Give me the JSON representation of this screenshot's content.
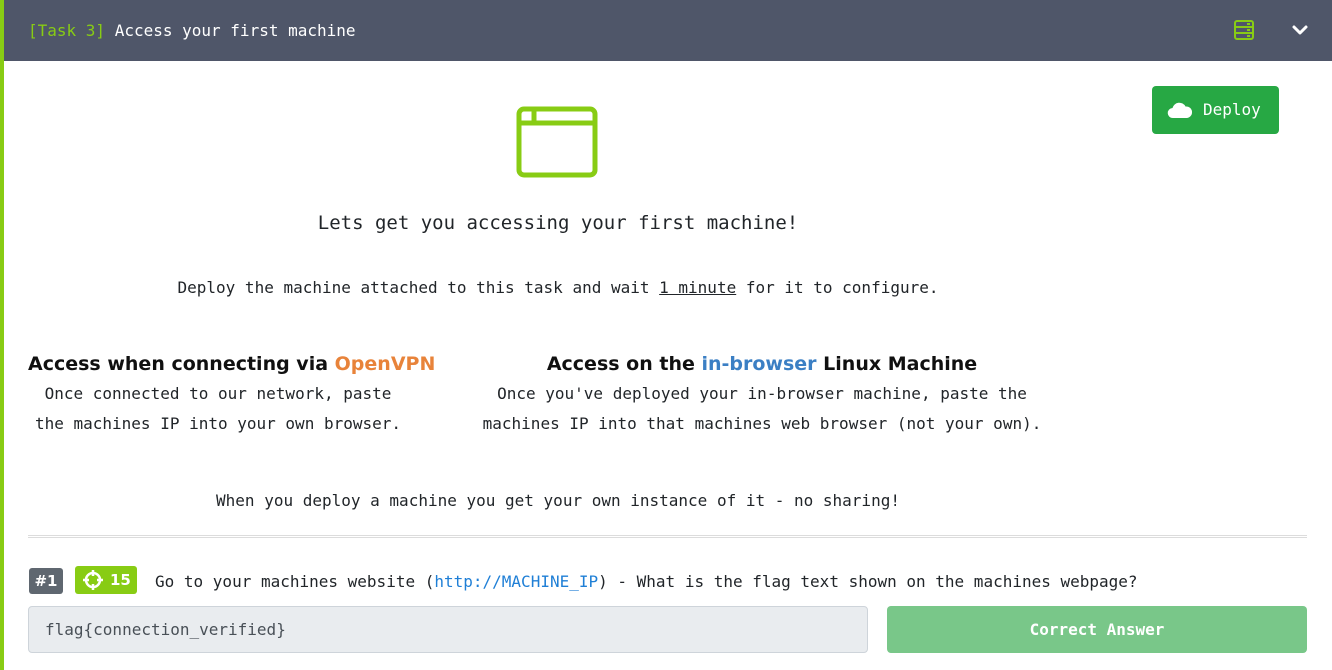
{
  "task": {
    "tag": "[Task 3]",
    "title": "Access your first machine"
  },
  "header_icons": [
    "machine-list-icon",
    "chevron-down-icon"
  ],
  "deploy_button": {
    "label": "Deploy",
    "icon": "cloud-icon"
  },
  "content": {
    "hero_icon": "browser-window-icon",
    "intro": "Lets get you accessing your first machine!",
    "deploy_note": {
      "before": "Deploy the machine attached to this task and wait ",
      "emphasis": "1 minute",
      "after": " for it to configure."
    },
    "openvpn_section": {
      "heading_prefix": "Access when connecting via ",
      "heading_highlight": "OpenVPN",
      "line1": "Once connected to our network, paste",
      "line2": "the machines IP into your own browser."
    },
    "browser_section": {
      "heading_prefix": "Access on the ",
      "heading_highlight": "in-browser",
      "heading_suffix": " Linux Machine",
      "line1": "Once you've deployed your in-browser machine, paste the",
      "line2": "machines IP into that machines web browser (not your own)."
    },
    "sharing_note": "When you deploy a machine you get your own instance of it - no sharing!"
  },
  "question": {
    "number": "#1",
    "points": "15",
    "points_icon": "crosshair-icon",
    "text_before": "Go to your machines website (",
    "link": "http://MACHINE_IP",
    "text_after": ") - What is the flag text shown on the machines webpage?",
    "answer_value": "flag{connection_verified}",
    "answer_button": "Correct Answer"
  },
  "colors": {
    "header_bg": "#4f5669",
    "accent_green": "#88cc14",
    "deploy_green": "#27a844",
    "correct_green": "#79c789",
    "openvpn_orange": "#e8833a",
    "inbrowser_blue": "#3b7fc4",
    "link_blue": "#1f7fd6"
  }
}
